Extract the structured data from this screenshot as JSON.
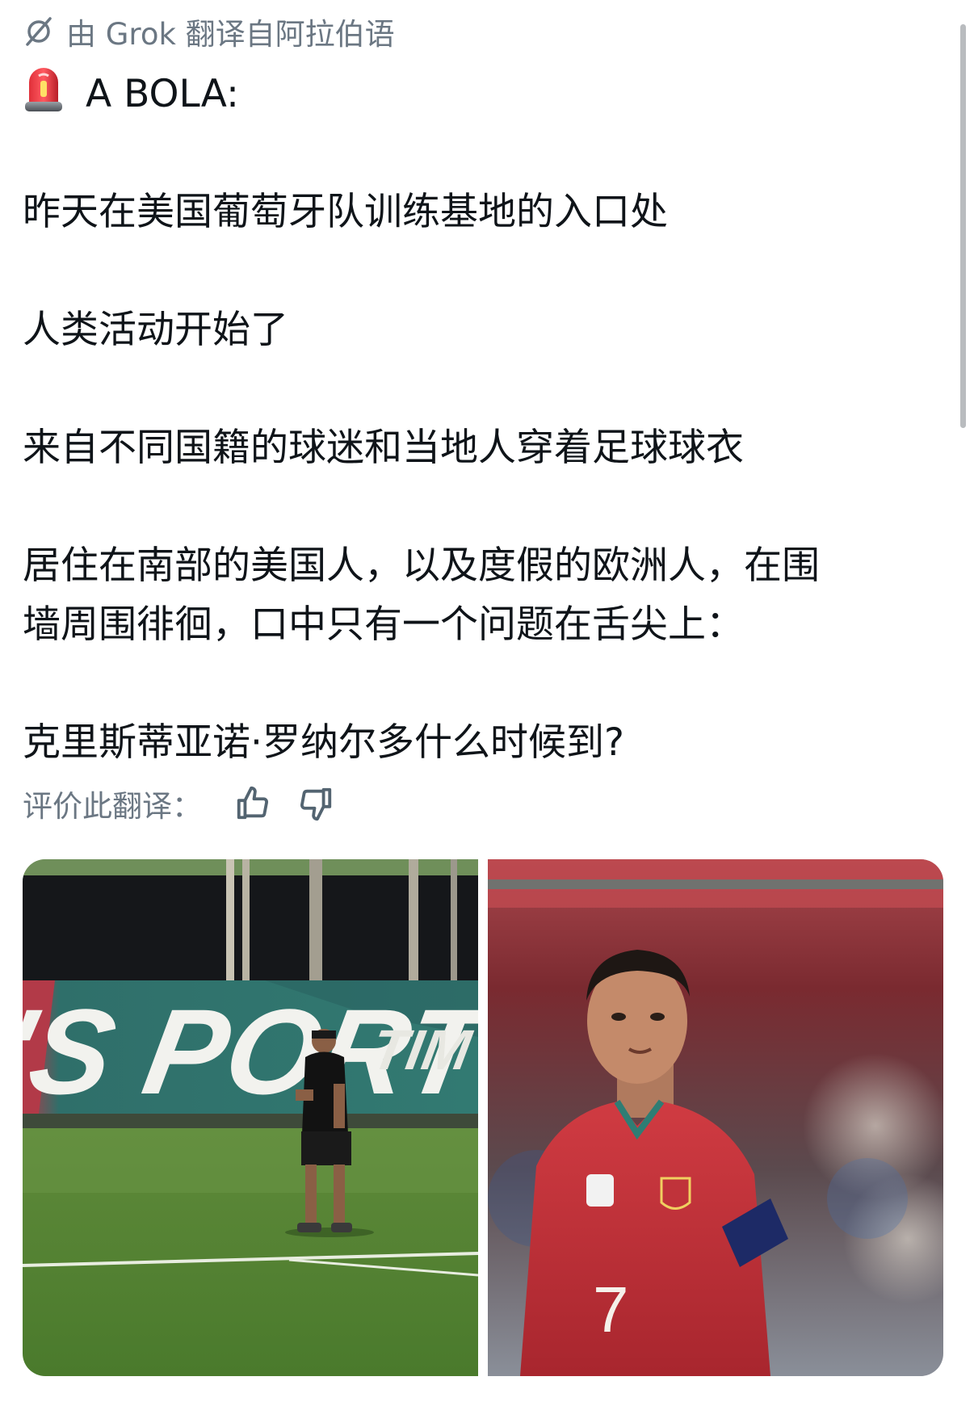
{
  "header": {
    "translated_by": "由 Grok 翻译自阿拉伯语",
    "icon": "grok-icon"
  },
  "tweet": {
    "emoji": "siren-emoji",
    "source": "A BOLA:",
    "lines": [
      "昨天在美国葡萄牙队训练基地的入口处",
      "人类活动开始了",
      "来自不同国籍的球迷和当地人穿着足球球衣",
      "居住在南部的美国人，以及度假的欧洲人，在围",
      "墙周围徘徊，口中只有一个问题在舌尖上：",
      "克里斯蒂亚诺·罗纳尔多什么时候到?"
    ]
  },
  "rating": {
    "label": "评价此翻译：",
    "like_icon": "thumbs-up-icon",
    "dislike_icon": "thumbs-down-icon"
  },
  "media": {
    "photo1": {
      "description": "training-field-photo",
      "banner_text": "'S PORTUGAL TIM"
    },
    "photo2": {
      "description": "player-portrait-photo",
      "shirt_number": "7"
    }
  },
  "colors": {
    "text": "#0f1419",
    "secondary": "#6b7783",
    "banner": "#2f6f6a",
    "jersey": "#c0333a"
  }
}
